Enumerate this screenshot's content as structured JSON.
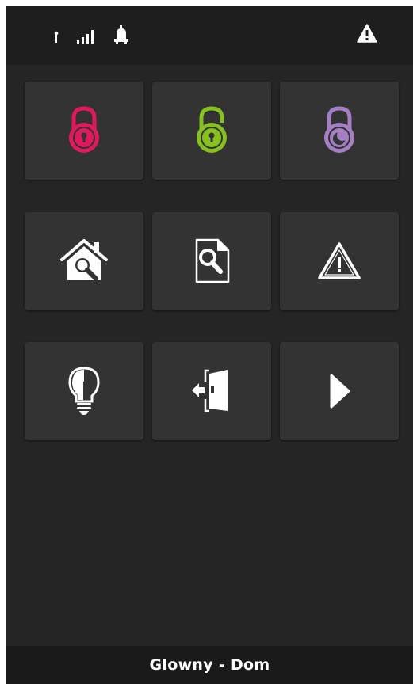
{
  "status_bar": {
    "icons": [
      "antenna-icon",
      "signal-bars-icon",
      "siren-icon",
      "alert-icon"
    ]
  },
  "tiles": [
    {
      "name": "arm-full-lock",
      "icon": "lock-closed-icon",
      "color": "#e0195e"
    },
    {
      "name": "disarm-lock",
      "icon": "lock-open-icon",
      "color": "#86c11f"
    },
    {
      "name": "night-arm-lock",
      "icon": "lock-night-icon",
      "color": "#a47fc4"
    },
    {
      "name": "zones-home",
      "icon": "home-search-icon",
      "color": "#ffffff"
    },
    {
      "name": "event-log",
      "icon": "document-search-icon",
      "color": "#ffffff"
    },
    {
      "name": "alarms",
      "icon": "warning-triangle-icon",
      "color": "#ffffff"
    },
    {
      "name": "lighting",
      "icon": "lightbulb-icon",
      "color": "#ffffff"
    },
    {
      "name": "exit-door",
      "icon": "door-exit-icon",
      "color": "#ffffff"
    },
    {
      "name": "next-page",
      "icon": "play-arrow-icon",
      "color": "#ffffff"
    }
  ],
  "footer": {
    "title": "Glowny - Dom"
  }
}
